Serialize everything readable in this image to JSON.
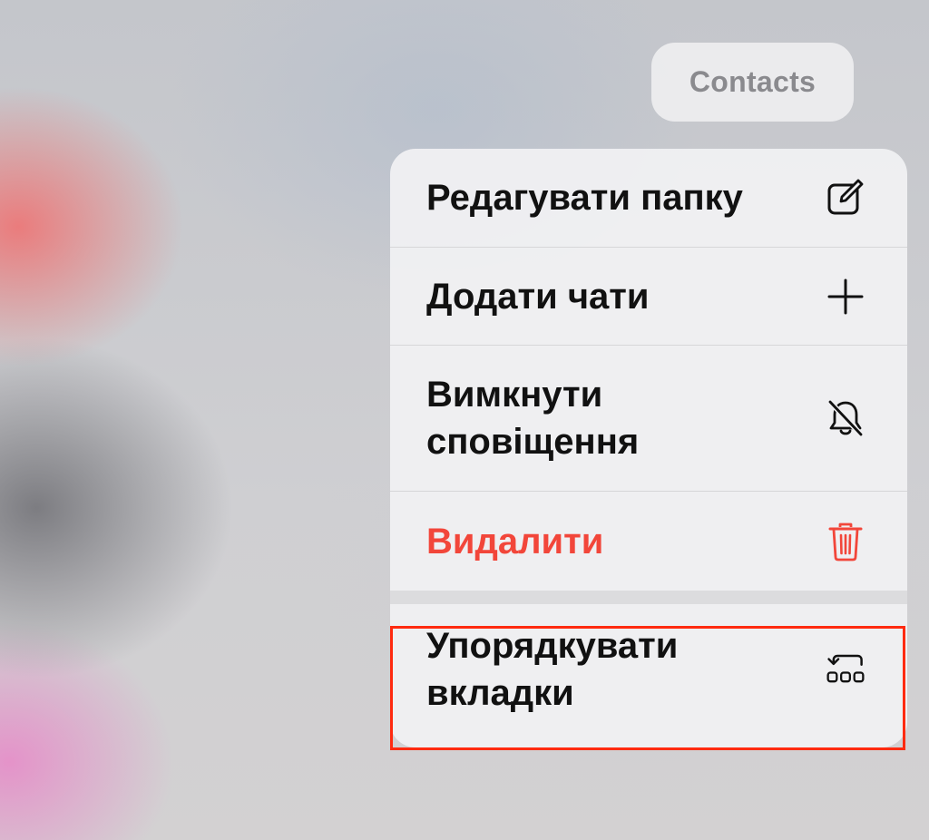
{
  "top_pill": {
    "label": "Contacts"
  },
  "menu": {
    "items": [
      {
        "label": "Редагувати папку",
        "icon": "edit-icon"
      },
      {
        "label": "Додати чати",
        "icon": "plus-icon"
      },
      {
        "label": "Вимкнути сповіщення",
        "icon": "bell-slash-icon"
      },
      {
        "label": "Видалити",
        "icon": "trash-icon",
        "color": "#f2463a"
      },
      {
        "label": "Упорядкувати вкладки",
        "icon": "reorder-tabs-icon"
      }
    ]
  },
  "highlight_color": "#ff2a10"
}
